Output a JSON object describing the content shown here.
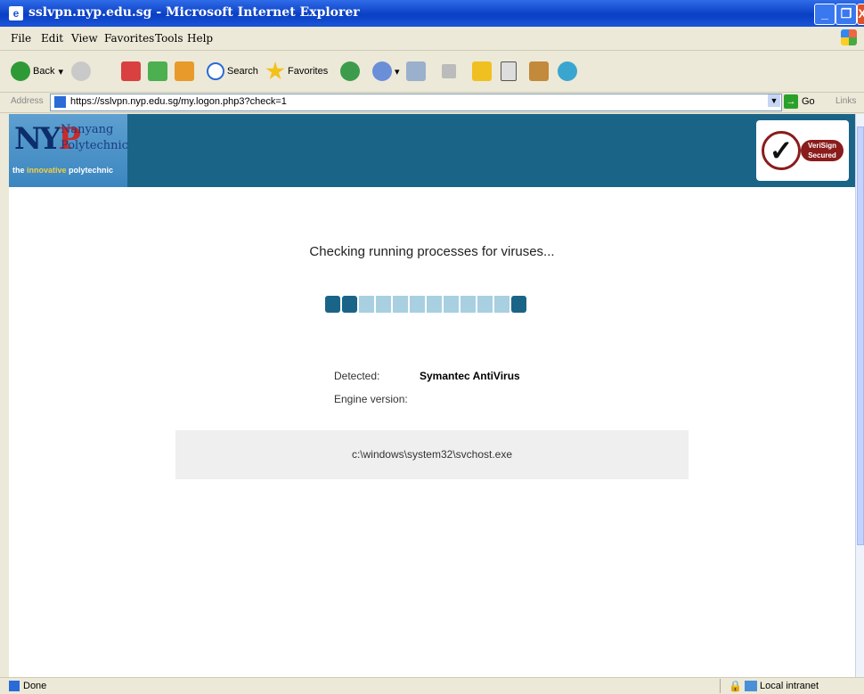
{
  "window": {
    "title": "sslvpn.nyp.edu.sg - Microsoft Internet Explorer",
    "min_symbol": "_",
    "max_symbol": "❐",
    "close_symbol": "X"
  },
  "menu": {
    "items": [
      "File",
      "Edit",
      "View",
      "Favorites",
      "Tools",
      "Help"
    ]
  },
  "toolbar": {
    "back_label": "Back",
    "search_label": "Search",
    "favorites_label": "Favorites"
  },
  "address": {
    "label": "Address",
    "url": "https://sslvpn.nyp.edu.sg/my.logon.php3?check=1",
    "go_label": "Go",
    "links_label": "Links"
  },
  "page": {
    "logo": {
      "mark_n": "N",
      "mark_y": "Y",
      "mark_p": "P",
      "name_line1": "Nanyang",
      "name_line2": "Polytechnic",
      "tagline_the": "the",
      "tagline_innovative": "innovative",
      "tagline_polytechnic": "polytechnic"
    },
    "verisign": {
      "check": "✓",
      "badge_line1": "VeriSign",
      "badge_line2": "Secured"
    },
    "status_message": "Checking running processes for viruses...",
    "progress": {
      "total_segments": 12,
      "active_segments": [
        0,
        1,
        11
      ]
    },
    "detected_label": "Detected:",
    "detected_value": "Symantec AntiVirus",
    "engine_label": "Engine version:",
    "file_path": "c:\\windows\\system32\\svchost.exe"
  },
  "statusbar": {
    "done_label": "Done",
    "zone_label": "Local intranet",
    "lock_symbol": "🔒"
  },
  "colors": {
    "header_bg": "#1a6487",
    "progress_active": "#1a6487",
    "progress_inactive": "#a8d0e0"
  }
}
